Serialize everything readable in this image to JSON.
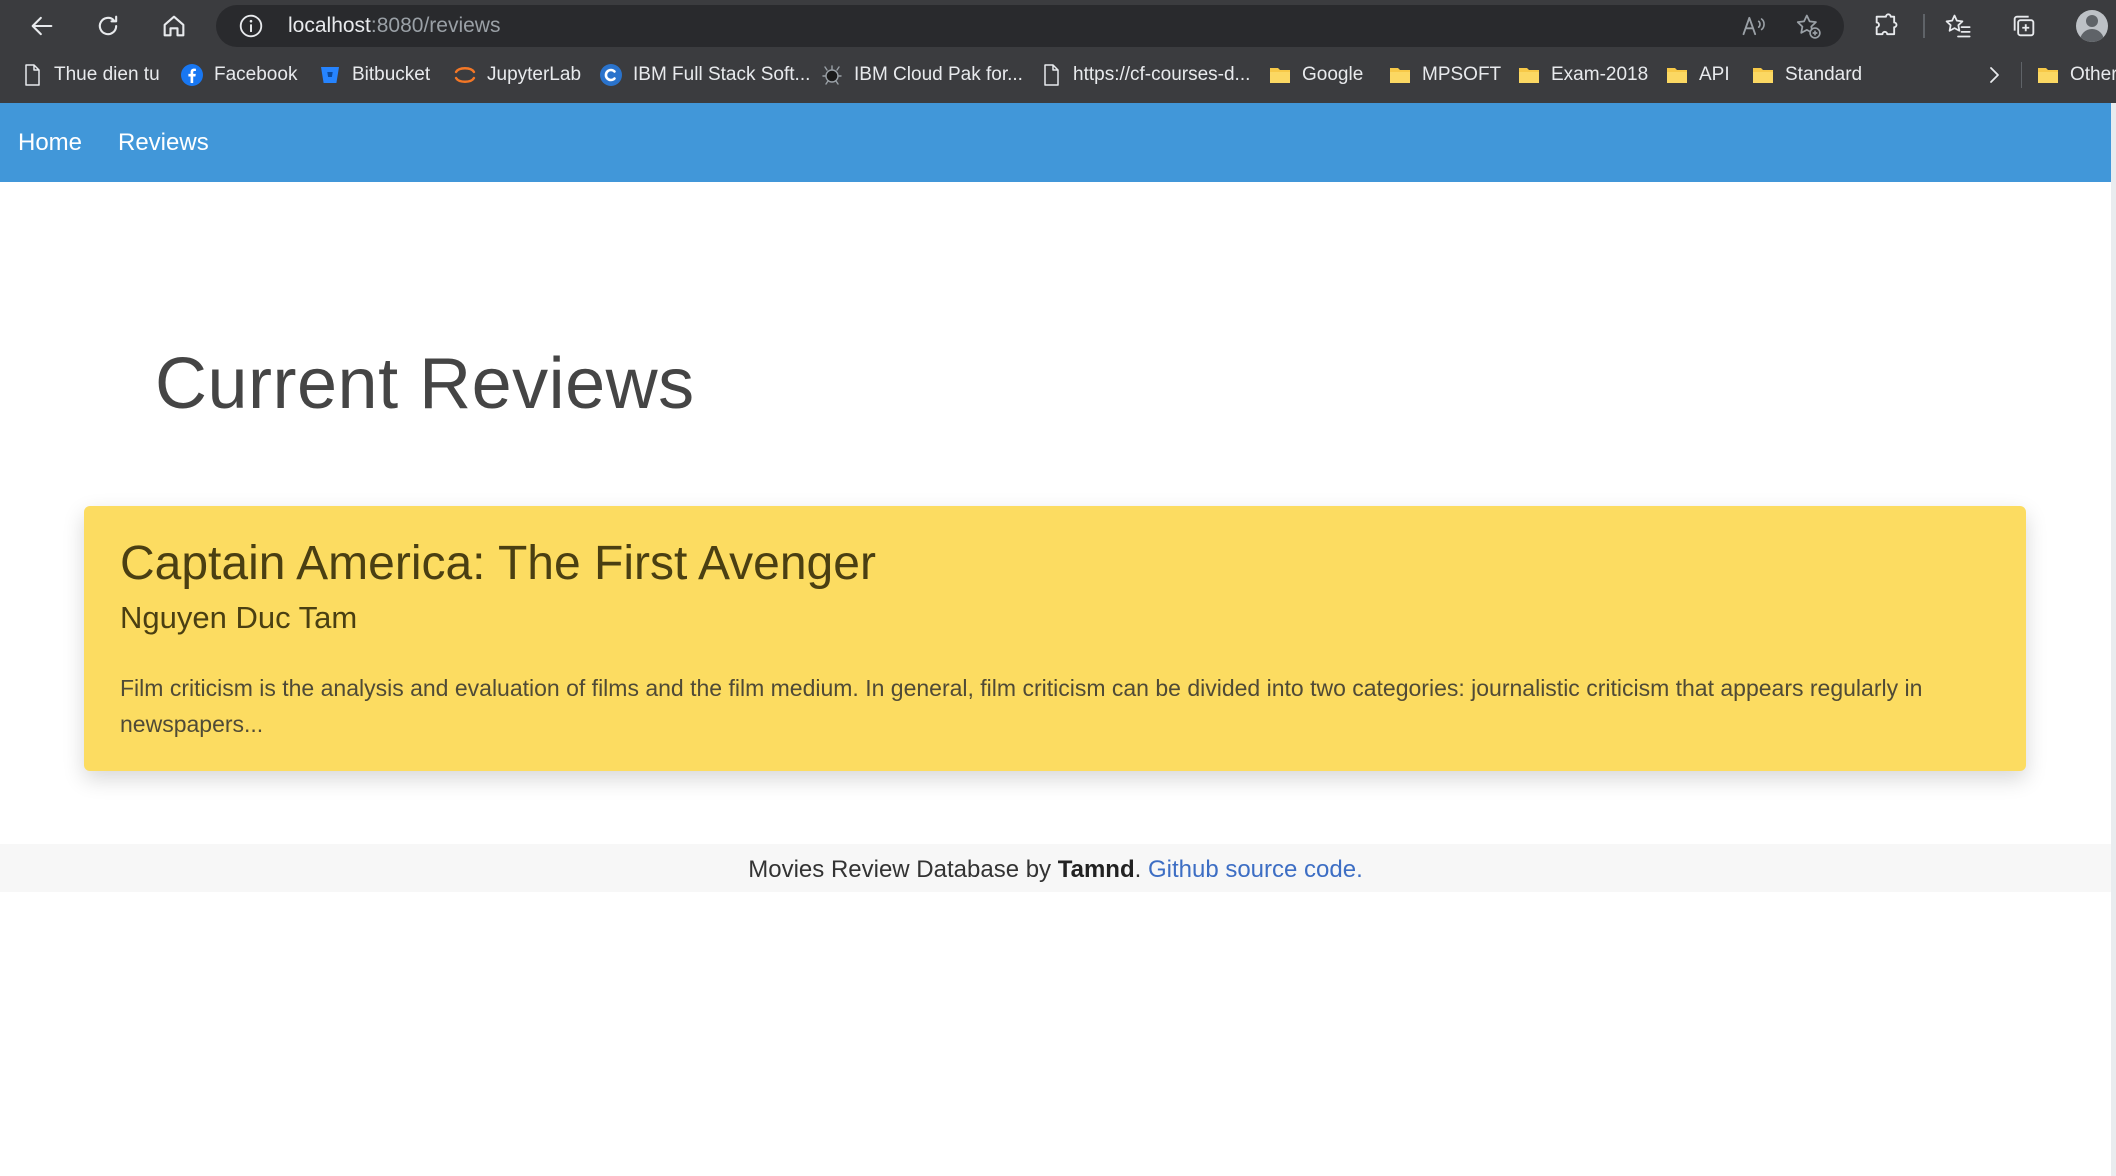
{
  "browser": {
    "url_host": "localhost",
    "url_path": ":8080/reviews",
    "bookmarks": [
      {
        "label": "Thue dien tu",
        "icon": "page-icon"
      },
      {
        "label": "Facebook",
        "icon": "facebook-icon"
      },
      {
        "label": "Bitbucket",
        "icon": "bitbucket-icon"
      },
      {
        "label": "JupyterLab",
        "icon": "jupyter-icon"
      },
      {
        "label": "IBM Full Stack Soft...",
        "icon": "coursera-icon"
      },
      {
        "label": "IBM Cloud Pak for...",
        "icon": "ibm-bee-icon"
      },
      {
        "label": "https://cf-courses-d...",
        "icon": "page-icon"
      },
      {
        "label": "Google",
        "icon": "folder-icon"
      },
      {
        "label": "MPSOFT",
        "icon": "folder-icon"
      },
      {
        "label": "Exam-2018",
        "icon": "folder-icon"
      },
      {
        "label": "API",
        "icon": "folder-icon"
      },
      {
        "label": "Standard",
        "icon": "folder-icon"
      },
      {
        "label": "Other",
        "icon": "folder-icon"
      }
    ]
  },
  "nav": {
    "home": "Home",
    "reviews": "Reviews"
  },
  "page": {
    "heading": "Current Reviews"
  },
  "review": {
    "title": "Captain America: The First Avenger",
    "author": "Nguyen Duc Tam",
    "excerpt": "Film criticism is the analysis and evaluation of films and the film medium. In general, film criticism can be divided into two categories: journalistic criticism that appears regularly in newspapers..."
  },
  "footer": {
    "prefix": "Movies Review Database by ",
    "author": "Tamnd",
    "separator": ". ",
    "link": "Github source code."
  },
  "colors": {
    "navbar": "#4197d9",
    "card": "#fcdc61",
    "link": "#3d6ec4"
  }
}
